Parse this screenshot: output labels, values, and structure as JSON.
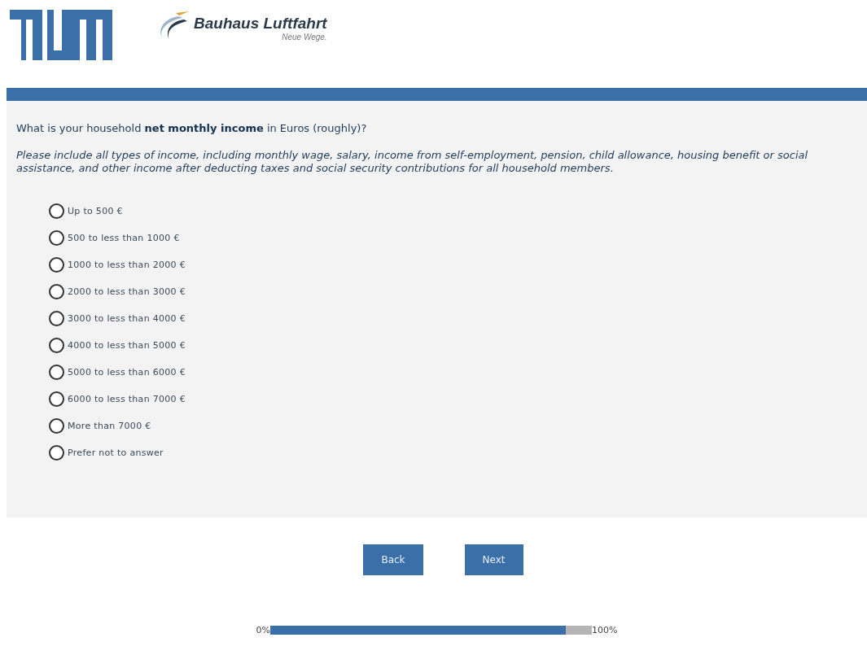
{
  "header": {
    "brand_name": "Bauhaus Luftfahrt",
    "brand_tagline": "Neue Wege."
  },
  "question": {
    "text": "What is your household **net monthly income** in Euros (roughly)?",
    "instructions": "Please include all types of income, including monthly wage, salary, income from self-employment, pension, child allowance, housing benefit or social assistance, and other income after deducting taxes and social security contributions for all household members."
  },
  "options": [
    {
      "label": "Up to 500 €",
      "selected": false
    },
    {
      "label": "500 to less than 1000 €",
      "selected": false
    },
    {
      "label": "1000 to less than 2000 €",
      "selected": false
    },
    {
      "label": "2000 to less than 3000 €",
      "selected": false
    },
    {
      "label": "3000 to less than 4000 €",
      "selected": false
    },
    {
      "label": "4000 to less than 5000 €",
      "selected": false
    },
    {
      "label": "5000 to less than 6000 €",
      "selected": false
    },
    {
      "label": "6000 to less than 7000 €",
      "selected": false
    },
    {
      "label": "More than 7000 €",
      "selected": false
    },
    {
      "label": "Prefer not to answer",
      "selected": false
    }
  ],
  "buttons": [
    "Back",
    "Next"
  ],
  "progress": {
    "start_label": "0%",
    "end_label": "100%",
    "level": 0.92
  }
}
